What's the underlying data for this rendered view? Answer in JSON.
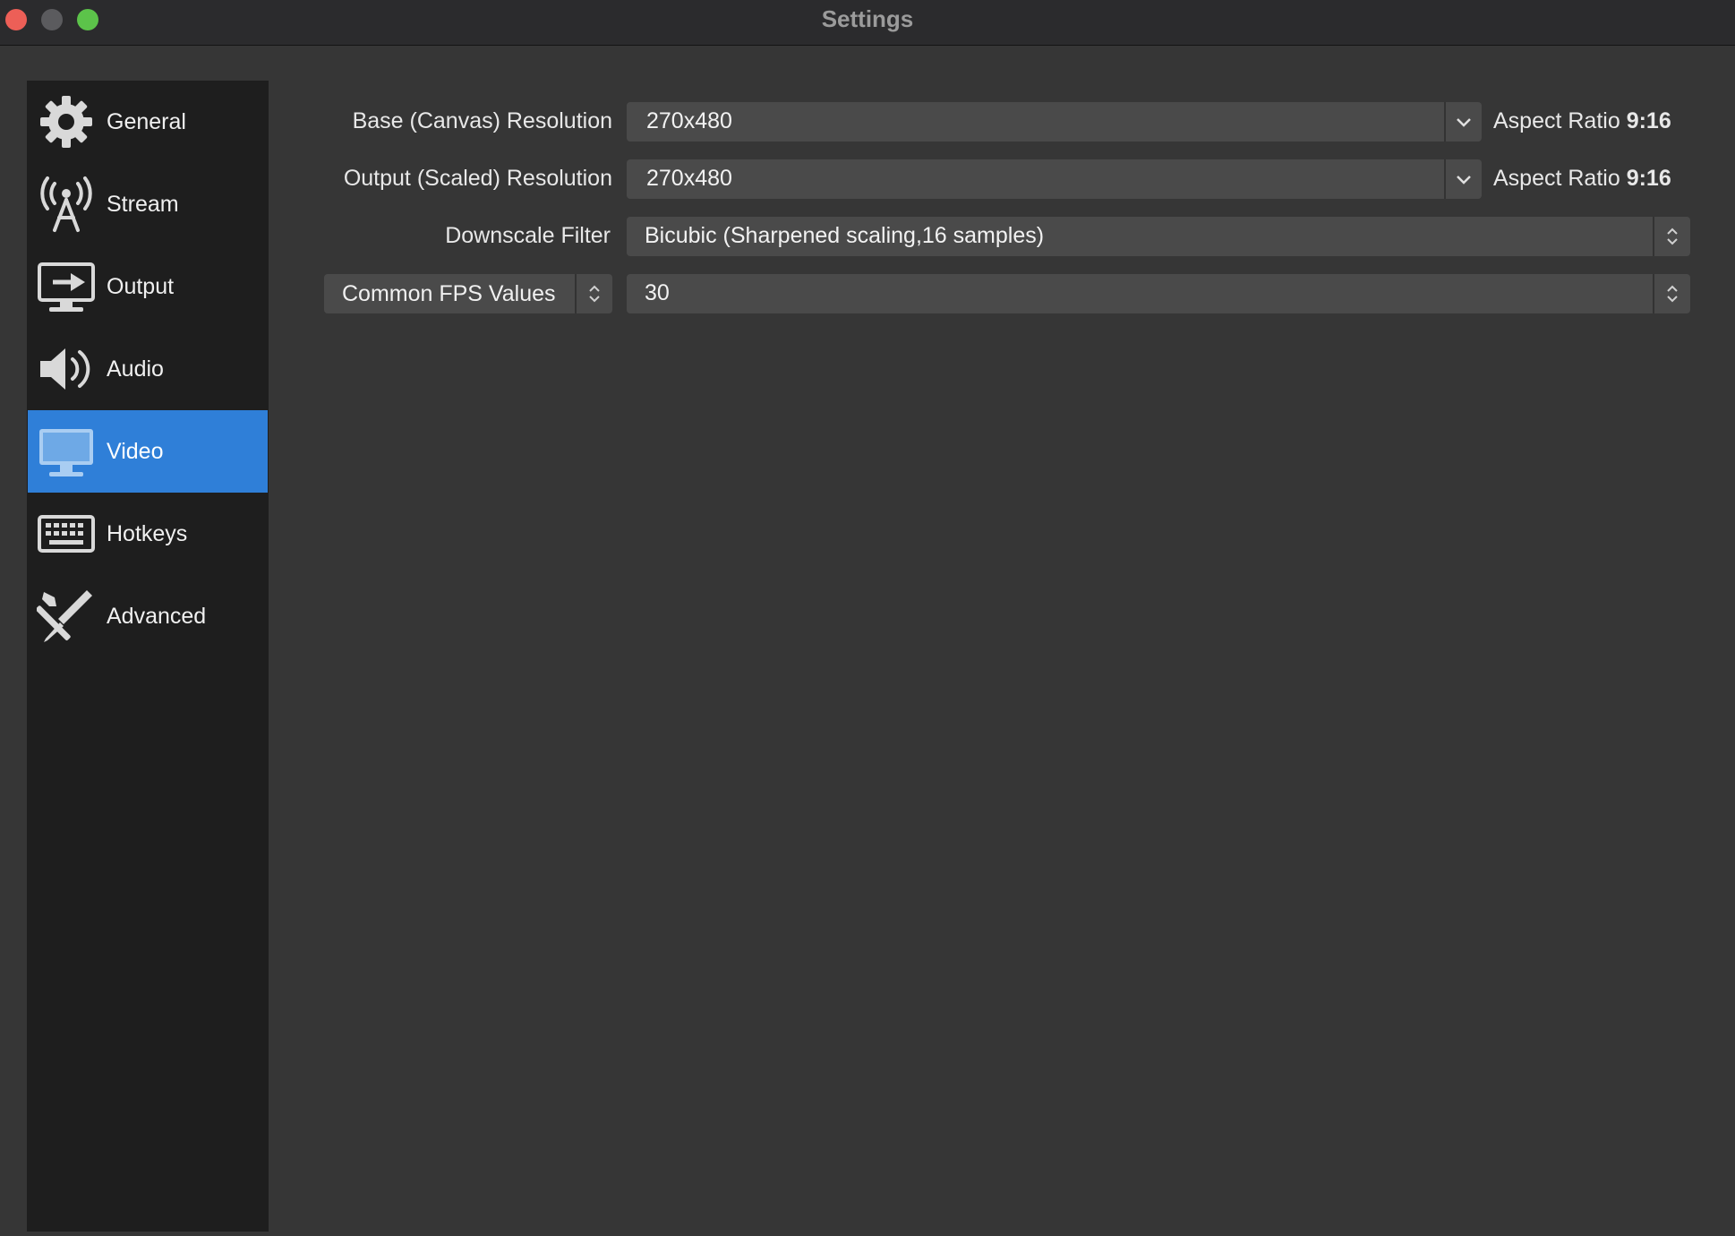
{
  "window": {
    "title": "Settings",
    "controls": [
      "close",
      "minimize",
      "zoom"
    ]
  },
  "sidebar": {
    "items": [
      {
        "label": "General",
        "icon": "gear-icon",
        "active": false
      },
      {
        "label": "Stream",
        "icon": "antenna-icon",
        "active": false
      },
      {
        "label": "Output",
        "icon": "output-monitor-icon",
        "active": false
      },
      {
        "label": "Audio",
        "icon": "speaker-icon",
        "active": false
      },
      {
        "label": "Video",
        "icon": "monitor-icon",
        "active": true
      },
      {
        "label": "Hotkeys",
        "icon": "keyboard-icon",
        "active": false
      },
      {
        "label": "Advanced",
        "icon": "tools-icon",
        "active": false
      }
    ]
  },
  "video": {
    "base_resolution": {
      "label": "Base (Canvas) Resolution",
      "value": "270x480",
      "aspect_prefix": "Aspect Ratio",
      "aspect_value": "9:16"
    },
    "output_resolution": {
      "label": "Output (Scaled) Resolution",
      "value": "270x480",
      "aspect_prefix": "Aspect Ratio",
      "aspect_value": "9:16"
    },
    "downscale_filter": {
      "label": "Downscale Filter",
      "value": "Bicubic (Sharpened scaling,16 samples)"
    },
    "fps": {
      "type_label": "Common FPS Values",
      "value": "30"
    }
  },
  "colors": {
    "accent": "#2f7fd8",
    "window_bg": "#363636",
    "sidebar_bg": "#1e1e1e",
    "field_bg": "#4a4a4a"
  }
}
